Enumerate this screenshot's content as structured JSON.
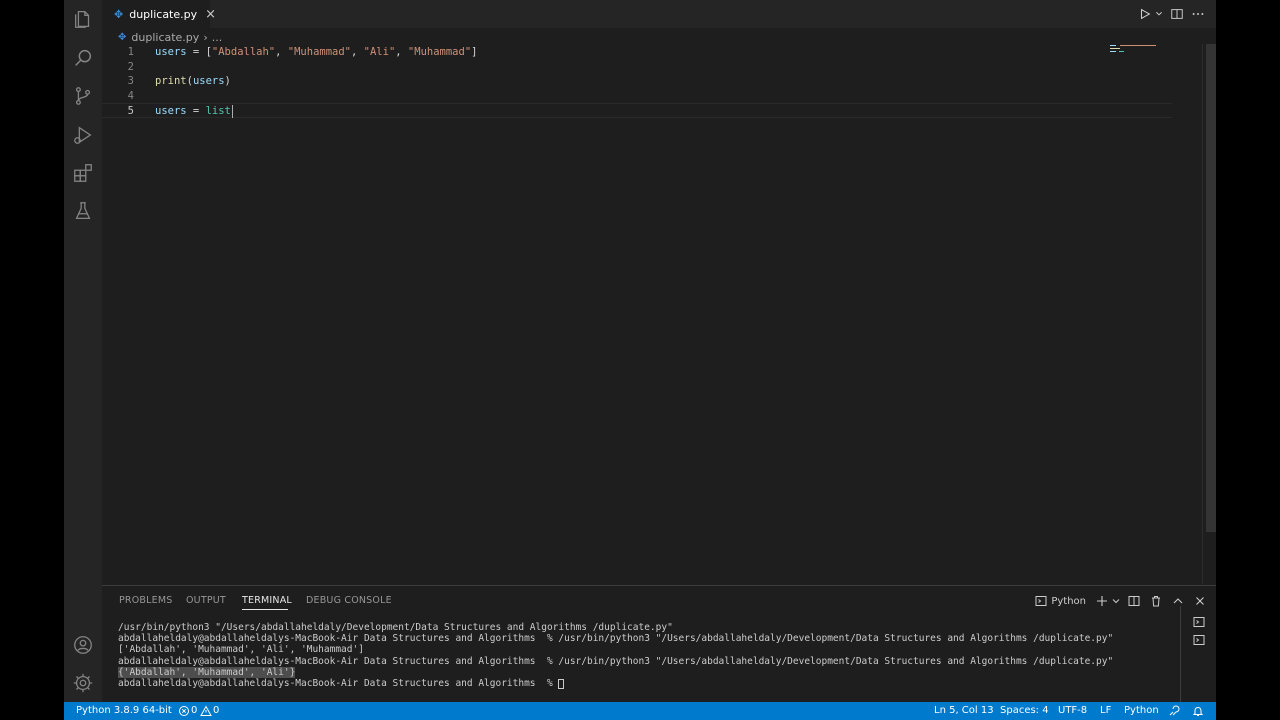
{
  "editor": {
    "tab": {
      "file_name": "duplicate.py",
      "close_glyph": "×",
      "file_icon_glyph": "✥"
    },
    "breadcrumb": {
      "file_name": "duplicate.py",
      "separator": "›",
      "ellipsis": "..."
    },
    "lines": [
      {
        "number": "1"
      },
      {
        "number": "2"
      },
      {
        "number": "3"
      },
      {
        "number": "4"
      },
      {
        "number": "5"
      }
    ],
    "code": {
      "l1_var": "users",
      "l1_eq": " = [",
      "l1_s1": "\"Abdallah\"",
      "l1_c1": ", ",
      "l1_s2": "\"Muhammad\"",
      "l1_c2": ", ",
      "l1_s3": "\"Ali\"",
      "l1_c3": ", ",
      "l1_s4": "\"Muhammad\"",
      "l1_end": "]",
      "l3_fn": "print",
      "l3_open": "(",
      "l3_arg": "users",
      "l3_close": ")",
      "l5_var": "users",
      "l5_eq": " = ",
      "l5_type": "list"
    }
  },
  "panel": {
    "tabs": [
      "PROBLEMS",
      "OUTPUT",
      "TERMINAL",
      "DEBUG CONSOLE"
    ],
    "active_tab": "TERMINAL",
    "terminal_name": "Python",
    "terminal_lines": [
      "/usr/bin/python3 \"/Users/abdallaheldaly/Development/Data Structures and Algorithms /duplicate.py\"",
      "abdallaheldaly@abdallaheldalys-MacBook-Air Data Structures and Algorithms  % /usr/bin/python3 \"/Users/abdallaheldaly/Development/Data Structures and Algorithms /duplicate.py\"",
      "['Abdallah', 'Muhammad', 'Ali', 'Muhammad']",
      "abdallaheldaly@abdallaheldalys-MacBook-Air Data Structures and Algorithms  % /usr/bin/python3 \"/Users/abdallaheldaly/Development/Data Structures and Algorithms /duplicate.py\"",
      "{'Abdallah', 'Muhammad', 'Ali'}",
      "abdallaheldaly@abdallaheldalys-MacBook-Air Data Structures and Algorithms  % "
    ]
  },
  "statusbar": {
    "interpreter": "Python 3.8.9 64-bit",
    "errors": "0",
    "warnings": "0",
    "position": "Ln 5, Col 13",
    "spaces": "Spaces: 4",
    "encoding": "UTF-8",
    "eol": "LF",
    "language": "Python"
  },
  "colors": {
    "accent": "#007acc",
    "editor_bg": "#1e1e1e",
    "sidebar_bg": "#252526",
    "string": "#ce9178",
    "variable": "#9cdcfe",
    "function": "#dcdcaa",
    "type": "#4ec9b0"
  }
}
